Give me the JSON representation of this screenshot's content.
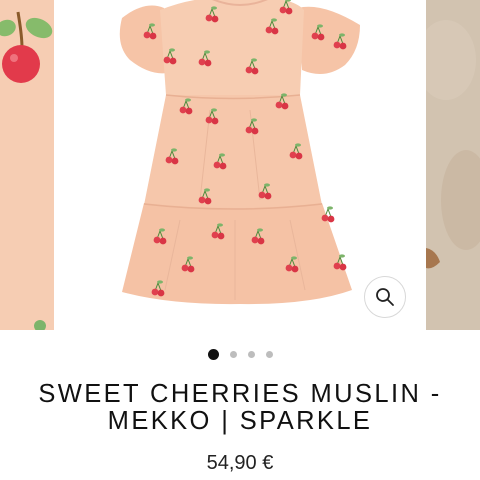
{
  "product": {
    "title_line1": "SWEET CHERRIES MUSLIN -",
    "title_line2": "MEKKO | SPARKLE",
    "price": "54,90 €"
  },
  "gallery": {
    "slide_count": 4,
    "active_slide": 1,
    "zoom_icon": "magnifier-icon"
  },
  "colors": {
    "fabric": "#f6c9ae",
    "cherry": "#e0404e",
    "leaf": "#7cb46a",
    "active_dot": "#111111",
    "inactive_dot": "#bdbdbd"
  }
}
